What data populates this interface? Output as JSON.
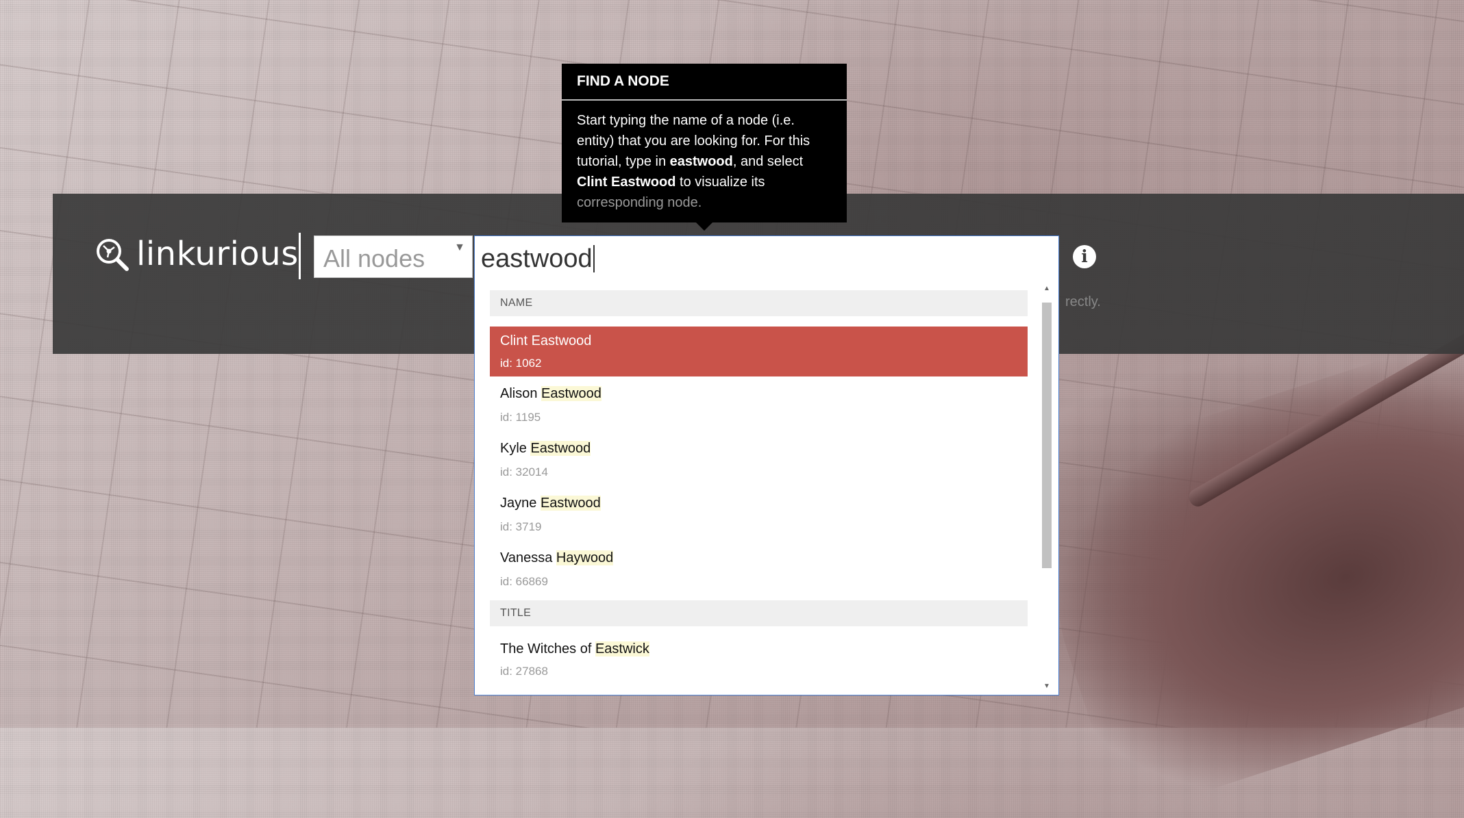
{
  "app": {
    "logo_text": "linkurious",
    "logo_icon": "search-graph-icon"
  },
  "search": {
    "scope_selected": "All nodes",
    "query": "eastwood",
    "hint_fragment": "rectly."
  },
  "tooltip": {
    "title": "FIND A NODE",
    "body_1": "Start typing the name of a node (i.e. entity) that you are looking for. For this tutorial, type in ",
    "keyword": "eastwood",
    "body_2": ", and select ",
    "target": "Clint Eastwood",
    "body_3": " to visualize its",
    "body_4": "corresponding node."
  },
  "results": {
    "groups": [
      {
        "header": "NAME",
        "items": [
          {
            "pre": "Clint Eastwood",
            "hl": "",
            "id": "id: 1062"
          },
          {
            "pre": "Alison ",
            "hl": "Eastwood",
            "id": "id: 1195"
          },
          {
            "pre": "Kyle ",
            "hl": "Eastwood",
            "id": "id: 32014"
          },
          {
            "pre": "Jayne ",
            "hl": "Eastwood",
            "id": "id: 3719"
          },
          {
            "pre": "Vanessa ",
            "hl": "Haywood",
            "id": "id: 66869"
          }
        ]
      },
      {
        "header": "TITLE",
        "items": [
          {
            "pre": "The Witches of ",
            "hl": "Eastwick",
            "id": "id: 27868"
          }
        ]
      }
    ]
  },
  "colors": {
    "selected": "#c9534a",
    "highlight": "#fbf8d6",
    "bar": "#3a3a3a"
  }
}
